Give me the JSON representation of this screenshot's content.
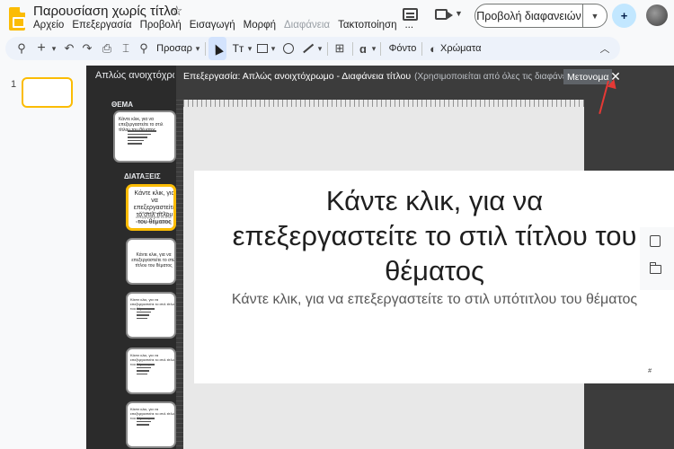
{
  "app": {
    "title": "Παρουσίαση χωρίς τίτλο",
    "menu": [
      "Αρχείο",
      "Επεξεργασία",
      "Προβολή",
      "Εισαγωγή",
      "Μορφή",
      "Διαφάνεια",
      "Τακτοποίηση",
      "..."
    ],
    "present_label": "Προβολή διαφανειών",
    "share_icon": "person-add-icon"
  },
  "toolbar": {
    "zoom_label": "Προσαρ",
    "text_format_label": "Tт",
    "background_label": "Φόντο",
    "colors_label": "Χρώματα"
  },
  "filmstrip": {
    "slide_number": "1"
  },
  "master": {
    "panel_title": "Απλώς ανοιχτόχρωμο",
    "theme_label": "ΘΕΜΑ",
    "layouts_label": "ΔΙΑΤΑΞΕΙΣ",
    "thumb_title": "Κάντε κλικ, για να επεξεργαστείτε το στιλ τίτλου του θέματος",
    "thumb_sub": "Κάντε κλικ, για να επεξεργαστείτε το στιλ υπότιτλου του θέματος",
    "thumb_small_title": "Κάντε κλικ, για να επεξεργαστείτε το στιλ τίτλου του θέματος"
  },
  "edit_bar": {
    "text": "Επεξεργασία: Απλώς ανοιχτόχρωμο - Διαφάνεια τίτλου",
    "hint": "(Χρησιμοποιείται από όλες τις διαφάνειες)",
    "rename_label": "Μετονομα",
    "close_label": "✕"
  },
  "slide": {
    "title": "Κάντε κλικ, για να επεξεργαστείτε το στιλ τίτλου του θέματος",
    "subtitle": "Κάντε κλικ, για να επεξεργαστείτε το στιλ υπότιτλου του θέματος",
    "number": "#"
  },
  "colors": {
    "accent": "#fbbc04",
    "annotation": "#e53935"
  }
}
